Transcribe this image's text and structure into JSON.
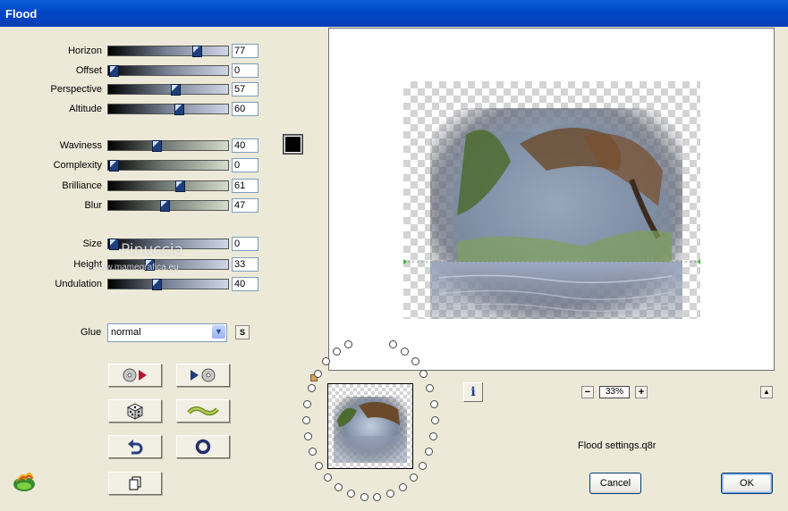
{
  "window": {
    "title": "Flood"
  },
  "sliders": [
    {
      "label": "Horizon",
      "value": "77",
      "level": 77,
      "style": "blue"
    },
    {
      "label": "Offset",
      "value": "0",
      "level": 0,
      "style": "blue"
    },
    {
      "label": "Perspective",
      "value": "57",
      "level": 57,
      "style": "blue"
    },
    {
      "label": "Altitude",
      "value": "60",
      "level": 60,
      "style": "blue"
    },
    {
      "label": "Waviness",
      "value": "40",
      "level": 40,
      "style": "green"
    },
    {
      "label": "Complexity",
      "value": "0",
      "level": 0,
      "style": "green"
    },
    {
      "label": "Brilliance",
      "value": "61",
      "level": 61,
      "style": "green"
    },
    {
      "label": "Blur",
      "value": "47",
      "level": 47,
      "style": "green"
    },
    {
      "label": "Size",
      "value": "0",
      "level": 0,
      "style": "blue"
    },
    {
      "label": "Height",
      "value": "33",
      "level": 33,
      "style": "blue"
    },
    {
      "label": "Undulation",
      "value": "40",
      "level": 40,
      "style": "blue"
    }
  ],
  "color_swatch": "#000000",
  "glue": {
    "label": "Glue",
    "value": "normal",
    "s_label": "S"
  },
  "watermark": {
    "line1": "Pinuccia",
    "line2": "www.mamegrafica.eu"
  },
  "zoom": {
    "value": "33%",
    "minus": "−",
    "plus": "+"
  },
  "info_label": "i",
  "up_label": "▲",
  "settings_file": "Flood settings.q8r",
  "buttons": {
    "cancel": "Cancel",
    "ok": "OK"
  },
  "colors": {
    "title_bar": "#0a5fd8",
    "dialog_bg": "#ece9d8"
  }
}
